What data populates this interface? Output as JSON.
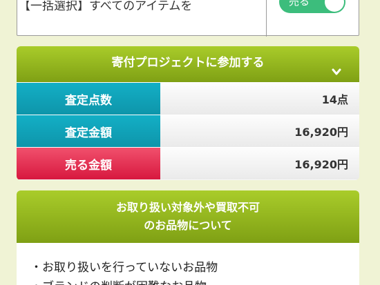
{
  "bulk_select": {
    "label": "【一括選択】すべてのアイテムを",
    "toggle_label": "売る"
  },
  "assessment": {
    "title": "寄付プロジェクトに参加する",
    "rows": [
      {
        "label": "査定点数",
        "value": "14点"
      },
      {
        "label": "査定金額",
        "value": "16,920円"
      },
      {
        "label": "売る金額",
        "value": "16,920円"
      }
    ]
  },
  "notice": {
    "title_line1": "お取り扱い対象外や買取不可",
    "title_line2": "のお品物について",
    "items": [
      "・お取り扱いを行っていないお品物",
      "・ブランドの判断が困難なお品物"
    ]
  },
  "colors": {
    "green_header": "#8fb41c",
    "teal": "#12a6bc",
    "red": "#e32a50",
    "toggle_on": "#3cbd7c"
  }
}
